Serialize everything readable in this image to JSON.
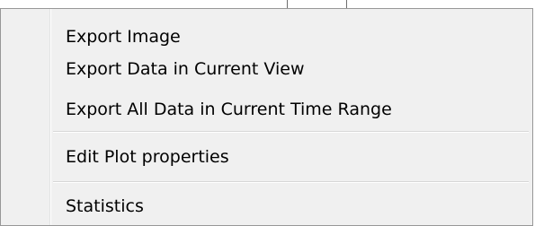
{
  "context_menu": {
    "items": [
      {
        "label": "Export Image"
      },
      {
        "label": "Export Data in Current View"
      },
      {
        "label": "Export All Data in Current Time Range"
      },
      {
        "label": "Edit Plot properties"
      },
      {
        "label": "Statistics"
      }
    ]
  },
  "colors": {
    "menu_background": "#f0f0f0",
    "menu_border": "#979797",
    "separator": "#d7d7d7",
    "text": "#000000"
  }
}
